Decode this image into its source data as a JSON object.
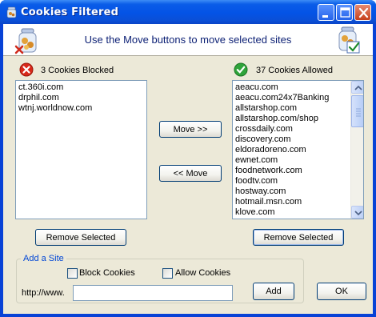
{
  "window": {
    "title": "Cookies Filtered",
    "title_buttons": [
      "minimize",
      "maximize",
      "close"
    ]
  },
  "banner": {
    "instruction": "Use the Move buttons to move selected sites",
    "left_icon": "cookie-jar-delete-icon",
    "right_icon": "cookie-jar-check-icon"
  },
  "blocked": {
    "header": "3 Cookies Blocked",
    "icon": "red-x-icon",
    "items": [
      "ct.360i.com",
      "drphil.com",
      "wtnj.worldnow.com"
    ],
    "remove_label": "Remove Selected"
  },
  "allowed": {
    "header": "37 Cookies Allowed",
    "icon": "green-check-icon",
    "items": [
      "aeacu.com",
      "aeacu.com24x7Banking",
      "allstarshop.com",
      "allstarshop.com/shop",
      "crossdaily.com",
      "discovery.com",
      "eldoradoreno.com",
      "ewnet.com",
      "foodnetwork.com",
      "foodtv.com",
      "hostway.com",
      "hotmail.msn.com",
      "klove.com"
    ],
    "remove_label": "Remove Selected"
  },
  "move": {
    "move_right_label": "Move >>",
    "move_left_label": "<< Move"
  },
  "add_site": {
    "group_label": "Add a Site",
    "block_label": "Block Cookies",
    "allow_label": "Allow Cookies",
    "prefix": "http://www.",
    "url_value": "",
    "add_label": "Add"
  },
  "ok_label": "OK",
  "colors": {
    "titlebar": "#0453e6",
    "client_bg": "#ece9d8",
    "banner_text": "#0b1f74",
    "group_label": "#0046d5"
  }
}
